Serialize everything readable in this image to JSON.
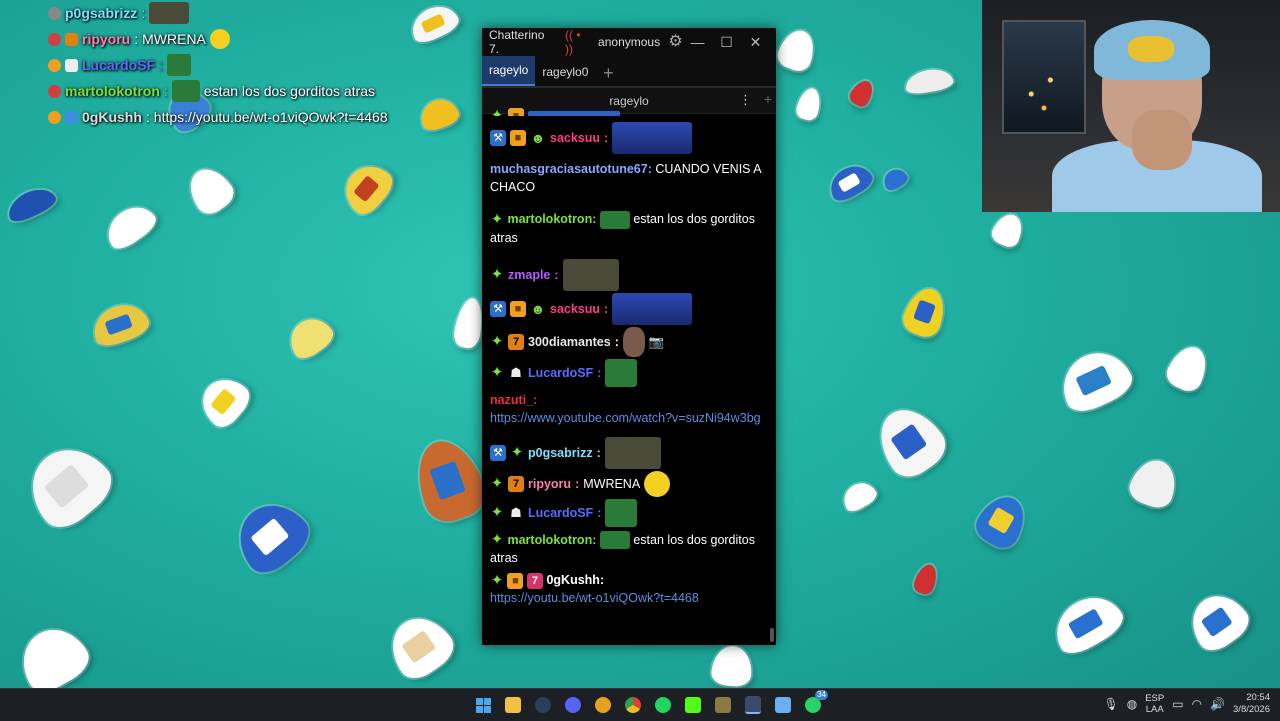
{
  "overlay_chat": [
    {
      "user": "p0gsabrizz",
      "text": ""
    },
    {
      "user": "ripyoru",
      "text": "MWRENA"
    },
    {
      "user": "LucardoSF",
      "text": ""
    },
    {
      "user": "martolokotron",
      "text": "estan los dos gorditos atras"
    },
    {
      "user": "0gKushh",
      "text": "https://youtu.be/wt-o1viQOwk?t=4468"
    }
  ],
  "chatterino": {
    "title": "Chatterino 7.",
    "live_icon": "(( • ))",
    "account": "anonymous",
    "tabs": [
      "rageylo",
      "rageylo0"
    ],
    "tab_add": "+",
    "split_channel": "rageylo",
    "split_menu": "⋮",
    "split_add": "+",
    "messages": [
      {
        "user": "sacksuu",
        "sep": ":",
        "text": "",
        "color": "#ff3c8c"
      },
      {
        "user": "muchasgraciasautotune67",
        "sep": ":",
        "text": "CUANDO VENIS A CHACO",
        "color": "#8aa8ff"
      },
      {
        "user": "martolokotron",
        "sep": ":",
        "text": "estan los dos gorditos atras",
        "color": "#7ee03a"
      },
      {
        "user": "zmaple",
        "sep": ":",
        "text": "",
        "color": "#b45cff"
      },
      {
        "user": "sacksuu",
        "sep": ":",
        "text": "",
        "color": "#ff3c8c"
      },
      {
        "user": "300diamantes",
        "sep": ":",
        "text": "📷",
        "color": "#ffffff"
      },
      {
        "user": "LucardoSF",
        "sep": ":",
        "text": "",
        "color": "#5a6bff"
      },
      {
        "user": "nazuti_",
        "sep": ":",
        "text": "https://www.youtube.com/watch?v=suzNi94w3bg",
        "color": "#e8303a"
      },
      {
        "user": "p0gsabrizz",
        "sep": ":",
        "text": "",
        "color": "#7ee0ff"
      },
      {
        "user": "ripyoru",
        "sep": ":",
        "text": "MWRENA",
        "color": "#ff7eb0"
      },
      {
        "user": "LucardoSF",
        "sep": ":",
        "text": "",
        "color": "#5a6bff"
      },
      {
        "user": "martolokotron",
        "sep": ":",
        "text": "estan los dos gorditos atras",
        "color": "#7ee03a"
      },
      {
        "user": "0gKushh",
        "sep": ":",
        "text": "https://youtu.be/wt-o1viQOwk?t=4468",
        "color": "#ffffff"
      }
    ]
  },
  "taskbar": {
    "lang_top": "ESP",
    "lang_bottom": "LAA",
    "time": "20:54",
    "date": "3/8/2026",
    "notification_count": "34"
  }
}
